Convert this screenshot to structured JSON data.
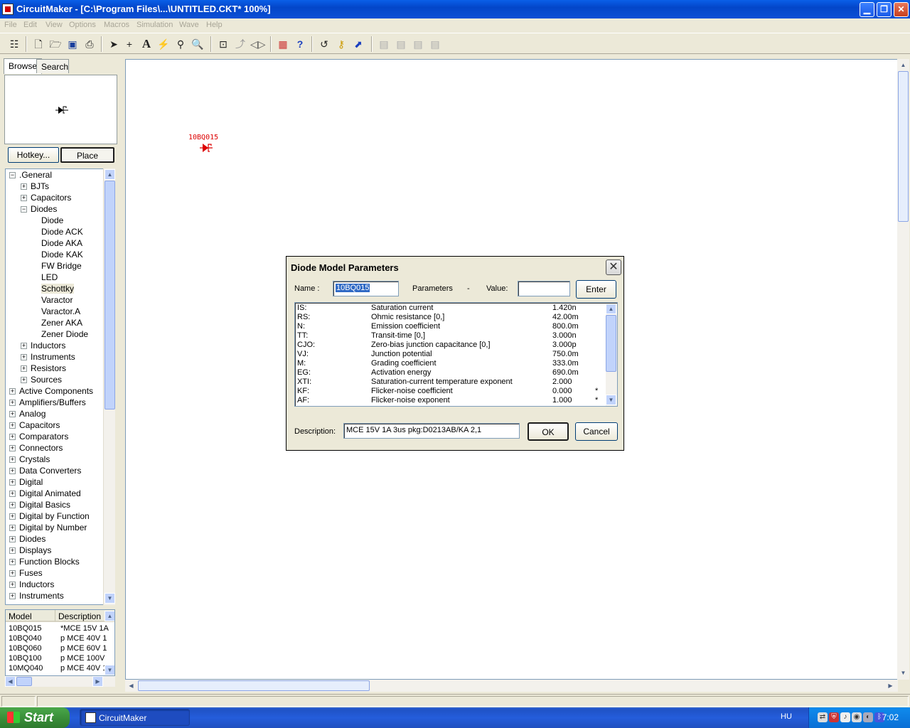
{
  "window": {
    "title": "CircuitMaker - [C:\\Program Files\\...\\UNTITLED.CKT* 100%]",
    "min_glyph": "▁",
    "max_glyph": "❐",
    "close_glyph": "✕"
  },
  "menu": [
    "File",
    "Edit",
    "View",
    "Options",
    "Macros",
    "Simulation",
    "Wave",
    "Help"
  ],
  "toolbar": {
    "icons": [
      "hierarchy-icon",
      "new-file-icon",
      "open-folder-icon",
      "save-icon",
      "print-icon",
      "arrow-pointer-icon",
      "wire-cross-icon",
      "text-icon",
      "probe-icon",
      "eyedropper-icon",
      "zoom-icon",
      "zoom-fit-icon",
      "rotate-icon",
      "mirror-icon",
      "netlist-icon",
      "help-icon",
      "reset-icon",
      "step-icon",
      "run-icon",
      "macro1-icon",
      "macro2-icon",
      "macro3-icon",
      "macro4-icon"
    ]
  },
  "browser": {
    "tabs": [
      "Browse",
      "Search"
    ],
    "hotkey_label": "Hotkey...",
    "place_label": "Place",
    "tree": [
      {
        "label": ".General",
        "level": 0,
        "expander": "−"
      },
      {
        "label": "BJTs",
        "level": 1,
        "expander": "+"
      },
      {
        "label": "Capacitors",
        "level": 1,
        "expander": "+"
      },
      {
        "label": "Diodes",
        "level": 1,
        "expander": "−"
      },
      {
        "label": "Diode",
        "level": 2,
        "expander": ""
      },
      {
        "label": "Diode ACK",
        "level": 2,
        "expander": ""
      },
      {
        "label": "Diode AKA",
        "level": 2,
        "expander": ""
      },
      {
        "label": "Diode KAK",
        "level": 2,
        "expander": ""
      },
      {
        "label": "FW Bridge",
        "level": 2,
        "expander": ""
      },
      {
        "label": "LED",
        "level": 2,
        "expander": ""
      },
      {
        "label": "Schottky",
        "level": 2,
        "expander": "",
        "selected": true
      },
      {
        "label": "Varactor",
        "level": 2,
        "expander": ""
      },
      {
        "label": "Varactor.A",
        "level": 2,
        "expander": ""
      },
      {
        "label": "Zener AKA",
        "level": 2,
        "expander": ""
      },
      {
        "label": "Zener Diode",
        "level": 2,
        "expander": ""
      },
      {
        "label": "Inductors",
        "level": 1,
        "expander": "+"
      },
      {
        "label": "Instruments",
        "level": 1,
        "expander": "+"
      },
      {
        "label": "Resistors",
        "level": 1,
        "expander": "+"
      },
      {
        "label": "Sources",
        "level": 1,
        "expander": "+"
      },
      {
        "label": "Active Components",
        "level": 0,
        "expander": "+"
      },
      {
        "label": "Amplifiers/Buffers",
        "level": 0,
        "expander": "+"
      },
      {
        "label": "Analog",
        "level": 0,
        "expander": "+"
      },
      {
        "label": "Capacitors",
        "level": 0,
        "expander": "+"
      },
      {
        "label": "Comparators",
        "level": 0,
        "expander": "+"
      },
      {
        "label": "Connectors",
        "level": 0,
        "expander": "+"
      },
      {
        "label": "Crystals",
        "level": 0,
        "expander": "+"
      },
      {
        "label": "Data Converters",
        "level": 0,
        "expander": "+"
      },
      {
        "label": "Digital",
        "level": 0,
        "expander": "+"
      },
      {
        "label": "Digital Animated",
        "level": 0,
        "expander": "+"
      },
      {
        "label": "Digital Basics",
        "level": 0,
        "expander": "+"
      },
      {
        "label": "Digital by Function",
        "level": 0,
        "expander": "+"
      },
      {
        "label": "Digital by Number",
        "level": 0,
        "expander": "+"
      },
      {
        "label": "Diodes",
        "level": 0,
        "expander": "+"
      },
      {
        "label": "Displays",
        "level": 0,
        "expander": "+"
      },
      {
        "label": "Function Blocks",
        "level": 0,
        "expander": "+"
      },
      {
        "label": "Fuses",
        "level": 0,
        "expander": "+"
      },
      {
        "label": "Inductors",
        "level": 0,
        "expander": "+"
      },
      {
        "label": "Instruments",
        "level": 0,
        "expander": "+"
      }
    ],
    "model_headers": [
      "Model",
      "Description"
    ],
    "models": [
      {
        "model": "10BQ015",
        "desc": "*MCE 15V 1A"
      },
      {
        "model": "10BQ040",
        "desc": "p MCE 40V 1"
      },
      {
        "model": "10BQ060",
        "desc": "p MCE 60V 1"
      },
      {
        "model": "10BQ100",
        "desc": "p MCE 100V"
      },
      {
        "model": "10MQ040",
        "desc": "p MCE 40V 1"
      }
    ]
  },
  "canvas": {
    "part_label": "10BQ015"
  },
  "dialog": {
    "title": "Diode Model Parameters",
    "close_glyph": "✕",
    "name_label": "Name :",
    "name_value": "10BQ015",
    "parameters_label": "Parameters",
    "dash": "-",
    "value_label": "Value:",
    "value_value": "",
    "enter_label": "Enter",
    "params": [
      {
        "key": "IS:",
        "desc": "Saturation current",
        "value": "1.420n",
        "flag": ""
      },
      {
        "key": "RS:",
        "desc": "Ohmic resistance [0,]",
        "value": "42.00m",
        "flag": ""
      },
      {
        "key": "N:",
        "desc": "Emission coefficient",
        "value": "800.0m",
        "flag": ""
      },
      {
        "key": "TT:",
        "desc": "Transit-time [0,]",
        "value": "3.000n",
        "flag": ""
      },
      {
        "key": "CJO:",
        "desc": "Zero-bias junction capacitance [0,]",
        "value": "3.000p",
        "flag": ""
      },
      {
        "key": "VJ:",
        "desc": "Junction potential",
        "value": "750.0m",
        "flag": ""
      },
      {
        "key": "M:",
        "desc": "Grading coefficient",
        "value": "333.0m",
        "flag": ""
      },
      {
        "key": "EG:",
        "desc": "Activation energy",
        "value": "690.0m",
        "flag": ""
      },
      {
        "key": "XTI:",
        "desc": "Saturation-current temperature exponent",
        "value": "2.000",
        "flag": ""
      },
      {
        "key": "KF:",
        "desc": "Flicker-noise coefficient",
        "value": "0.000",
        "flag": "*"
      },
      {
        "key": "AF:",
        "desc": "Flicker-noise exponent",
        "value": "1.000",
        "flag": "*"
      }
    ],
    "description_label": "Description:",
    "description_value": "MCE 15V 1A 3us pkg:D0213AB/KA 2,1",
    "ok_label": "OK",
    "cancel_label": "Cancel"
  },
  "taskbar": {
    "start_label": "Start",
    "task_label": "CircuitMaker",
    "language": "HU",
    "clock": "7:02"
  }
}
